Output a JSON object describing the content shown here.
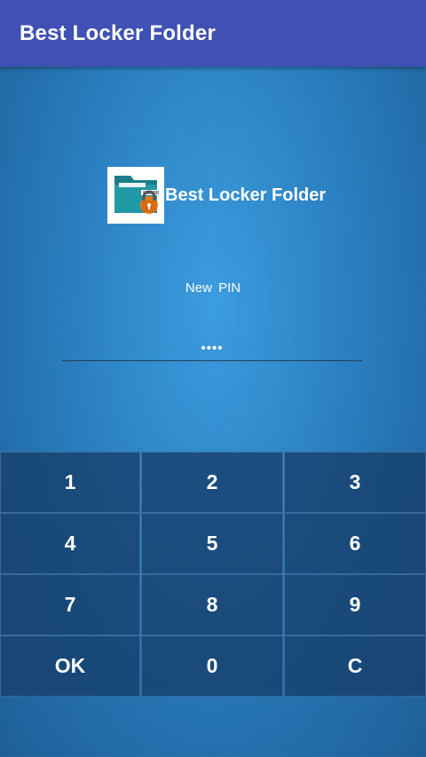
{
  "app_bar": {
    "title": "Best Locker Folder"
  },
  "header": {
    "logo_icon": "locked-folder-icon",
    "app_name": "Best Locker Folder"
  },
  "pin": {
    "label": "New  PIN",
    "value": "••••"
  },
  "keypad": {
    "keys": [
      "1",
      "2",
      "3",
      "4",
      "5",
      "6",
      "7",
      "8",
      "9",
      "OK",
      "0",
      "C"
    ]
  },
  "colors": {
    "app_bar": "#3f51b5",
    "background": "#2d86c9",
    "key_background": "#1f4f7d"
  }
}
